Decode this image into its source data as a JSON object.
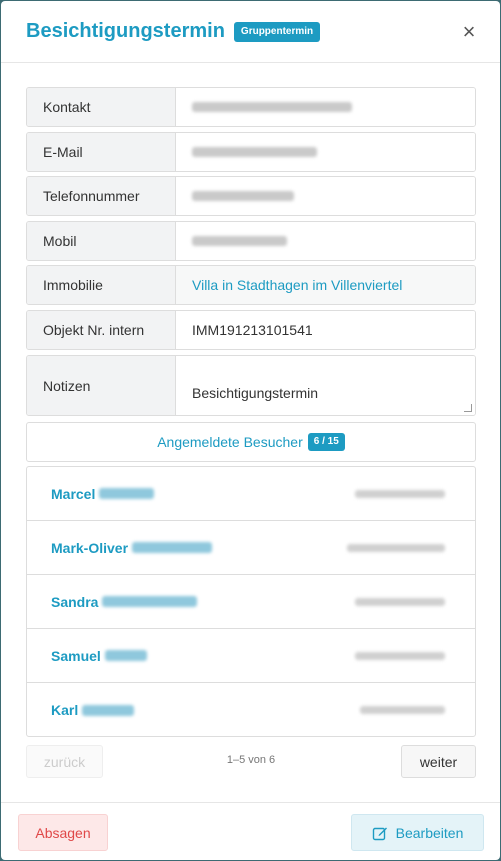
{
  "header": {
    "title": "Besichtigungstermin",
    "badge": "Gruppentermin",
    "close_icon": "×"
  },
  "fields": {
    "contact": {
      "label": "Kontakt"
    },
    "email": {
      "label": "E-Mail"
    },
    "phone": {
      "label": "Telefonnummer"
    },
    "mobile": {
      "label": "Mobil"
    },
    "property": {
      "label": "Immobilie",
      "value": "Villa in Stadthagen im Villenviertel"
    },
    "object_nr": {
      "label": "Objekt Nr. intern",
      "value": "IMM191213101541"
    },
    "notes": {
      "label": "Notizen",
      "value": "Besichtigungstermin"
    }
  },
  "visitors": {
    "heading": "Angemeldete Besucher",
    "count": "6 / 15",
    "items": [
      {
        "name": "Marcel"
      },
      {
        "name": "Mark-Oliver"
      },
      {
        "name": "Sandra"
      },
      {
        "name": "Samuel"
      },
      {
        "name": "Karl"
      }
    ]
  },
  "pager": {
    "prev": "zurück",
    "info": "1–5 von 6",
    "next": "weiter"
  },
  "footer": {
    "cancel": "Absagen",
    "edit": "Bearbeiten",
    "edit_icon": "edit-icon"
  },
  "colors": {
    "accent": "#1d9bc2",
    "danger": "#e04848"
  }
}
